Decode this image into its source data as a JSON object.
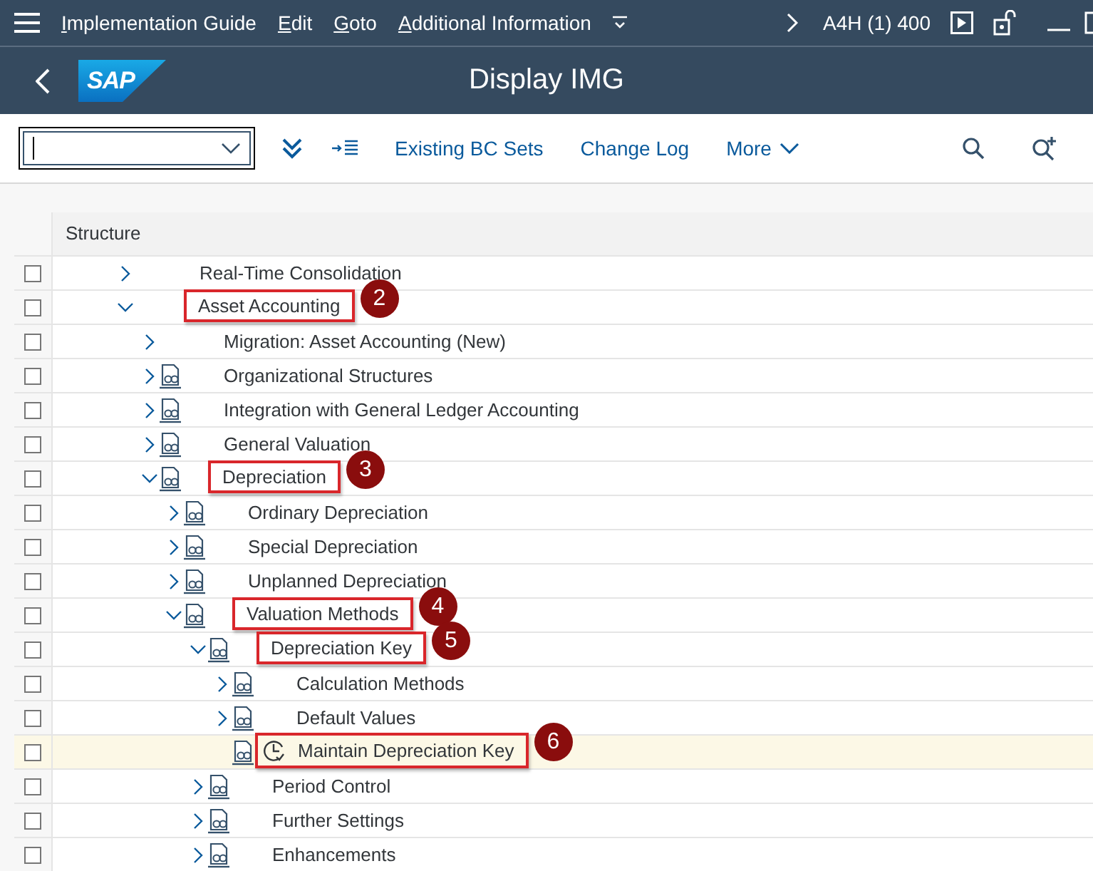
{
  "menu_bar": {
    "items": [
      "Implementation Guide",
      "Edit",
      "Goto",
      "Additional Information"
    ],
    "system": "A4H (1) 400"
  },
  "title_bar": {
    "logo": "SAP",
    "title": "Display IMG"
  },
  "toolbar": {
    "buttons": [
      "Existing BC Sets",
      "Change Log",
      "More"
    ]
  },
  "table": {
    "columns": [
      "Structure"
    ],
    "rows": [
      {
        "label": "Real-Time Consolidation",
        "expanded": false,
        "doc": false,
        "checked": false,
        "selected": false
      },
      {
        "label": "Asset Accounting",
        "expanded": true,
        "doc": false,
        "checked": false,
        "selected": false,
        "callout": "2",
        "children": [
          {
            "label": "Migration: Asset Accounting (New)",
            "expanded": false,
            "doc": false,
            "checked": false,
            "selected": false
          },
          {
            "label": "Organizational Structures",
            "expanded": false,
            "doc": true,
            "checked": false,
            "selected": false
          },
          {
            "label": "Integration with General Ledger Accounting",
            "expanded": false,
            "doc": true,
            "checked": false,
            "selected": false
          },
          {
            "label": "General Valuation",
            "expanded": false,
            "doc": true,
            "checked": false,
            "selected": false
          },
          {
            "label": "Depreciation",
            "expanded": true,
            "doc": true,
            "checked": false,
            "selected": false,
            "callout": "3",
            "children": [
              {
                "label": "Ordinary Depreciation",
                "expanded": false,
                "doc": true,
                "checked": false,
                "selected": false
              },
              {
                "label": "Special Depreciation",
                "expanded": false,
                "doc": true,
                "checked": false,
                "selected": false
              },
              {
                "label": "Unplanned Depreciation",
                "expanded": false,
                "doc": true,
                "checked": false,
                "selected": false
              },
              {
                "label": "Valuation Methods",
                "expanded": true,
                "doc": true,
                "checked": false,
                "selected": false,
                "callout": "4",
                "children": [
                  {
                    "label": "Depreciation Key",
                    "expanded": true,
                    "doc": true,
                    "checked": false,
                    "selected": false,
                    "callout": "5",
                    "children": [
                      {
                        "label": "Calculation Methods",
                        "expanded": false,
                        "doc": true,
                        "checked": false,
                        "selected": false
                      },
                      {
                        "label": "Default Values",
                        "expanded": false,
                        "doc": true,
                        "checked": false,
                        "selected": false
                      },
                      {
                        "label": "Maintain Depreciation Key",
                        "kind": "activity",
                        "doc": true,
                        "checked": false,
                        "selected": true,
                        "callout": "6"
                      }
                    ]
                  },
                  {
                    "label": "Period Control",
                    "expanded": false,
                    "doc": true,
                    "checked": false,
                    "selected": false
                  },
                  {
                    "label": "Further Settings",
                    "expanded": false,
                    "doc": true,
                    "checked": false,
                    "selected": false
                  },
                  {
                    "label": "Enhancements",
                    "expanded": false,
                    "doc": true,
                    "checked": false,
                    "selected": false
                  }
                ]
              }
            ]
          }
        ]
      }
    ]
  }
}
